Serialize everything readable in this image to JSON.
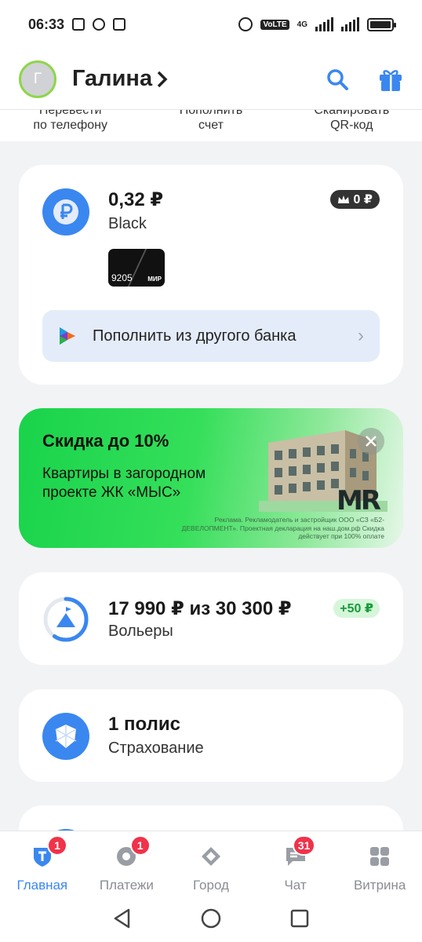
{
  "status_bar": {
    "time": "06:33",
    "network": "4G",
    "volte": "VoLTE",
    "sim": "1 2"
  },
  "header": {
    "avatar_initial": "Г",
    "user_name": "Галина"
  },
  "quick_actions": [
    {
      "line1": "Перевести",
      "line2": "по телефону"
    },
    {
      "line1": "Пополнить",
      "line2": "счет"
    },
    {
      "line1": "Сканировать",
      "line2": "QR-код"
    }
  ],
  "account": {
    "amount": "0,32 ₽",
    "name": "Black",
    "cashback": "0 ₽",
    "card_number": "9205",
    "card_system": "МИР",
    "topup_label": "Пополнить из другого банка"
  },
  "promo": {
    "title": "Скидка до 10%",
    "subtitle": "Квартиры в загородном проекте ЖК «МЫС»",
    "logo": "MR",
    "legal": "Реклама. Рекламодатель и застройщик ООО «СЗ «Б2-ДЕВЕЛОПМЕНТ». Проектная декларация на наш.дом.рф Скидка действует при 100% оплате"
  },
  "goal": {
    "amount": "17 990 ₽ из 30 300 ₽",
    "name": "Вольеры",
    "badge": "+50 ₽",
    "progress": 0.594
  },
  "insurance": {
    "count": "1 полис",
    "name": "Страхование"
  },
  "tabbar": {
    "home": {
      "label": "Главная",
      "badge": "1"
    },
    "payments": {
      "label": "Платежи",
      "badge": "1"
    },
    "city": {
      "label": "Город"
    },
    "chat": {
      "label": "Чат",
      "badge": "31"
    },
    "showcase": {
      "label": "Витрина"
    }
  },
  "colors": {
    "accent": "#3a87f0",
    "promo_green": "#2bd651",
    "badge_red": "#f0324a",
    "success_green": "#1a9b3c"
  }
}
